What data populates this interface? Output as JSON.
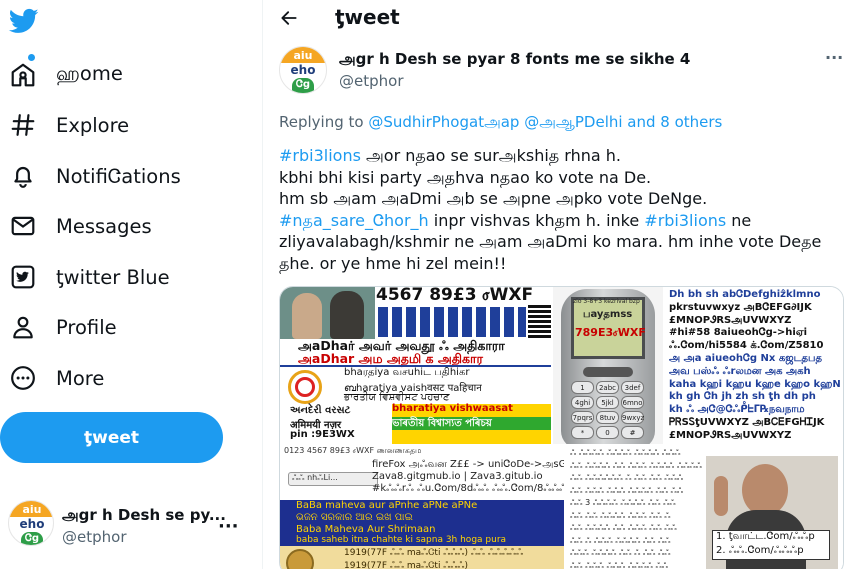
{
  "nav": {
    "items": [
      {
        "label": "ஹome"
      },
      {
        "label": "Explore"
      },
      {
        "label": "NotifiᏣations"
      },
      {
        "label": "Messages"
      },
      {
        "label": "ƫwitter Blue"
      },
      {
        "label": "Profile"
      },
      {
        "label": "More"
      }
    ],
    "tweet_button": "ƫweet"
  },
  "account": {
    "name": "அgr h Desh se py...",
    "handle": "@etphor",
    "avatar_text": {
      "top": "aiu",
      "mid": "eho",
      "bottom": "Ꮳg"
    }
  },
  "header": {
    "title": "ƫweet"
  },
  "tweet": {
    "author_name": "அgr h Desh se pyar 8 fonts me se sikhe 4",
    "author_handle": "@etphor",
    "replying_prefix": "Replying to",
    "replying_to": "@SudhirPhogatஅap @அஆPDelhi and 8 others",
    "lines": [
      [
        {
          "t": "#rbi3lions",
          "h": true
        },
        {
          "t": " அor nதao se surஅkshiத rhna h."
        }
      ],
      [
        {
          "t": "kbhi bhi kisi party அதhva nதao ko vote na De."
        }
      ],
      [
        {
          "t": "hm sb அam அaDmi அb se அpne அpko vote DeNge."
        }
      ],
      [
        {
          "t": "#nதa_sare_Ꮳhor_h",
          "h": true
        },
        {
          "t": " inpr vishvas khதm h. inke "
        },
        {
          "t": "#rbi3lions",
          "h": true
        },
        {
          "t": " ne"
        }
      ],
      [
        {
          "t": "zliyavalabagh/kshmir ne அam அaDmi ko mara. hm inhe vote Deதe"
        }
      ],
      [
        {
          "t": "தhe. or ye hme hi zel mein!!"
        }
      ]
    ]
  },
  "media": {
    "img1": {
      "top_text": "4567 89£3 ⳝWXF",
      "line_a": "அaDhaர் அவர் அவதூ ஃ அதிகாரா",
      "line_b": "அaDhar  அம அதமி க அதிகார",
      "line_c": "bhaரதiya வசuhiட பதிhiகr",
      "line_d": "ബharatiya vaishवसट पaहिचान",
      "line_e": "ਭਾਰਤੀਯ ਵਿਸ਼ਵੀਸਟ ਪਹਚਾਣ",
      "line_f": "bharatiya vishwaasat",
      "line_g": "ভাৰতীয় বিশ্বাস্যত পৰিচয়",
      "line_h": "અનદેરી વરસટ",
      "line_i": "अमिमयी नज़र",
      "line_j": "pin :9E3WX"
    },
    "img2": {
      "screen_top": "zio 3-8+3 kezrival bzp",
      "screen_a": "பayதmss",
      "screen_b": "789E3ⳝWXF",
      "keys": [
        "1",
        "2abc",
        "3def",
        "4ghi",
        "5jkl",
        "6mno",
        "7pqrs",
        "8tuv",
        "9wxyz",
        "*",
        "0",
        "#"
      ],
      "right_lines": [
        "Dh bh sh abᏣDefghiẑklmno",
        "pkrstuvwxyz அBᏣEFG∂IJK",
        "£MNOPᏭRSஅUVWXYZ",
        "#hi#58 8aiueohᏣg->hiஏi",
        "ஃ.Ꮳom/hi5584 க்.Ꮳom/Z5810",
        "அ அa aiueohᏣg Nx கஜடதபத",
        "அவ பஸ்ஃ ஃrலமன அக அகh",
        "kaha kஹi kஹu kஹe kஹo kஹN",
        "kh gh Ꮳh jh zh sh ƫh dh ph",
        "kh ஃ அᏣ@Ꮳஃᑬᖶᒥ℞நவநாம",
        "ᏢᏒSᏚƫUVWXYZ அBᏟᎬFGᎻᏆJK",
        "£MNOPᏭRSஅUVWXYZ"
      ]
    },
    "img3": {
      "top": "0123 4567 89£3 ⳝWXF ணனணகதம",
      "box_a": "ஃஃ nhஃLi...",
      "line_a": "fireFox அஃவன Z££ -> uniᏣoDe->அsGii",
      "line_b": "Zava8.gitgmub.io | Zava3.gitub.io",
      "line_c": "#kஃஃrஃ ஃu.Ꮳom/8dஃஃ ஃஃ.Ꮳom/8ஃஃஃ",
      "line_d": "BaBa maheva aur aPnhe aPNe aPNe",
      "line_e": "ଭଜନ ସରକାର ଆର ଇଖ ପାଇ",
      "line_f": "Baba Maheva Aur Shrimaan",
      "line_g": "baba saheb itna chahte ki sapna 3h hoga pura",
      "line_h": "1919(77F ஃஃ maஃᏣti ஃஃஃ) ஃஃ ஃஃஃஃஃ",
      "line_i": "1919(77F ஃஃ maஃᏣti ஃஃஃ)"
    },
    "img4": {
      "lines": [
        "ஃ ஃஃஃஃ ஃஃஃஃ ஃஃஃஃ ஃஃஃ",
        "ஃஃ ஃஃஃஃ ஃஃ ஃஃஃ ஃஃஃஃ ஃஃஃஃ",
        "ஃஃ ஃஃஃஃஃஃ ஃ ஃஃ ஃஃ ஃஃஃ",
        "ஃஃ ஃஃஃ ஃஃஃ ஃஃஃஃ ஃஃ ஃஃ",
        "ஃஃ 3 ஃஃஃஃ ஃஃஃஃ ஃஃ ஃஃ",
        "ஃஃ ஃஃ ஃஃஃஃ ஃஃஃ ஃஃ ஃ",
        "ஃஃ ஃஃஃஃ ஃஃ ஃஃஃ ஃஃ ஃஃ",
        "ஃஃ ஃ ஃஃஃ ஃஃஃஃ ஃஃ ஃஃ",
        "ஃஃஃ ஃஃஃஃ ஃஃ ஃ ஃஃ ஃஃ",
        "ஃஃ ஃஃஃ ஃஃஃ ஃஃஃஃ ஃஃ"
      ],
      "caption_a": "1. ƫவாட்ட.Ꮳom/ஃஃp",
      "caption_b": "2. ஃஃ.Ꮳom/ஃஃஃp"
    }
  },
  "colors": {
    "accent": "#1d9bf0",
    "text": "#0f1419",
    "secondary": "#536471"
  }
}
